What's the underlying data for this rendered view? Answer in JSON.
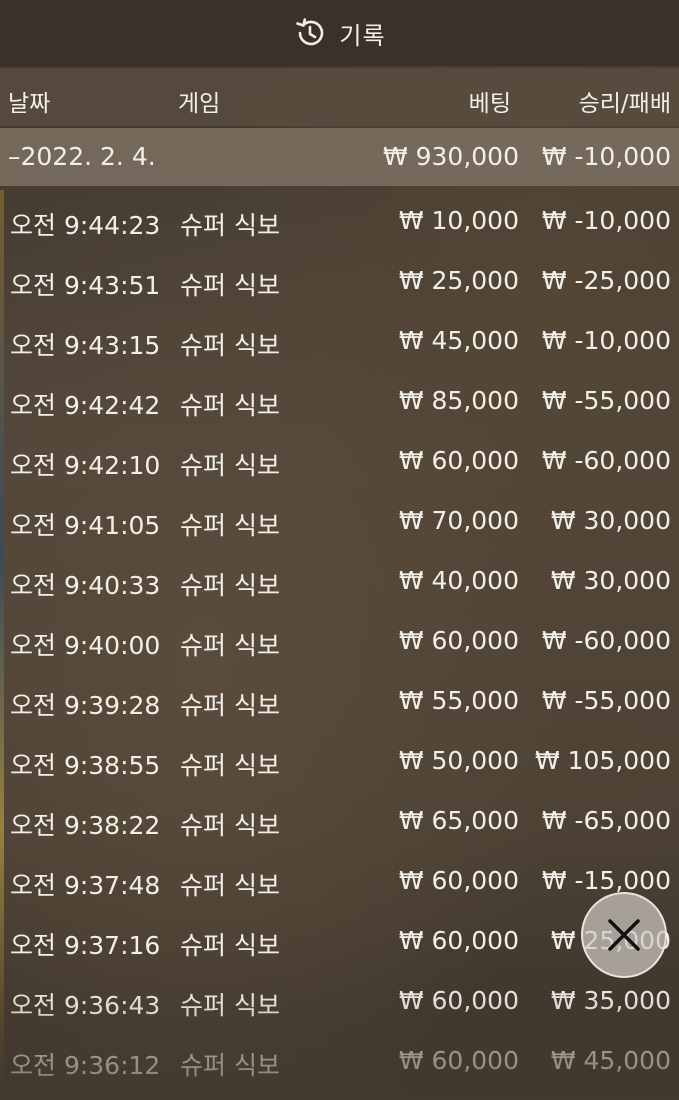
{
  "header": {
    "title": "기록",
    "icon": "history-icon"
  },
  "columns": {
    "date": "날짜",
    "game": "게임",
    "bet": "베팅",
    "winloss": "승리/패배"
  },
  "summary": {
    "date": "–2022. 2. 4.",
    "bet": "₩ 930,000",
    "winloss": "₩ -10,000"
  },
  "rows": [
    {
      "time": "오전 9:44:23",
      "game": "슈퍼 식보",
      "bet": "₩ 10,000",
      "winloss": "₩ -10,000"
    },
    {
      "time": "오전 9:43:51",
      "game": "슈퍼 식보",
      "bet": "₩ 25,000",
      "winloss": "₩ -25,000"
    },
    {
      "time": "오전 9:43:15",
      "game": "슈퍼 식보",
      "bet": "₩ 45,000",
      "winloss": "₩ -10,000"
    },
    {
      "time": "오전 9:42:42",
      "game": "슈퍼 식보",
      "bet": "₩ 85,000",
      "winloss": "₩ -55,000"
    },
    {
      "time": "오전 9:42:10",
      "game": "슈퍼 식보",
      "bet": "₩ 60,000",
      "winloss": "₩ -60,000"
    },
    {
      "time": "오전 9:41:05",
      "game": "슈퍼 식보",
      "bet": "₩ 70,000",
      "winloss": "₩ 30,000"
    },
    {
      "time": "오전 9:40:33",
      "game": "슈퍼 식보",
      "bet": "₩ 40,000",
      "winloss": "₩ 30,000"
    },
    {
      "time": "오전 9:40:00",
      "game": "슈퍼 식보",
      "bet": "₩ 60,000",
      "winloss": "₩ -60,000"
    },
    {
      "time": "오전 9:39:28",
      "game": "슈퍼 식보",
      "bet": "₩ 55,000",
      "winloss": "₩ -55,000"
    },
    {
      "time": "오전 9:38:55",
      "game": "슈퍼 식보",
      "bet": "₩ 50,000",
      "winloss": "₩ 105,000"
    },
    {
      "time": "오전 9:38:22",
      "game": "슈퍼 식보",
      "bet": "₩ 65,000",
      "winloss": "₩ -65,000"
    },
    {
      "time": "오전 9:37:48",
      "game": "슈퍼 식보",
      "bet": "₩ 60,000",
      "winloss": "₩ -15,000"
    },
    {
      "time": "오전 9:37:16",
      "game": "슈퍼 식보",
      "bet": "₩ 60,000",
      "winloss": "₩ 25,000"
    },
    {
      "time": "오전 9:36:43",
      "game": "슈퍼 식보",
      "bet": "₩ 60,000",
      "winloss": "₩ 35,000"
    },
    {
      "time": "오전 9:36:12",
      "game": "슈퍼 식보",
      "bet": "₩ 60,000",
      "winloss": "₩ 45,000"
    }
  ],
  "close_button": {
    "icon": "close-icon"
  },
  "colors": {
    "header_bg": "#3a322a",
    "column_header_bg": "#5a4e40",
    "summary_row_bg": "#7a6e60",
    "text": "#f2efe9",
    "close_button_bg": "#cdc8c2"
  }
}
